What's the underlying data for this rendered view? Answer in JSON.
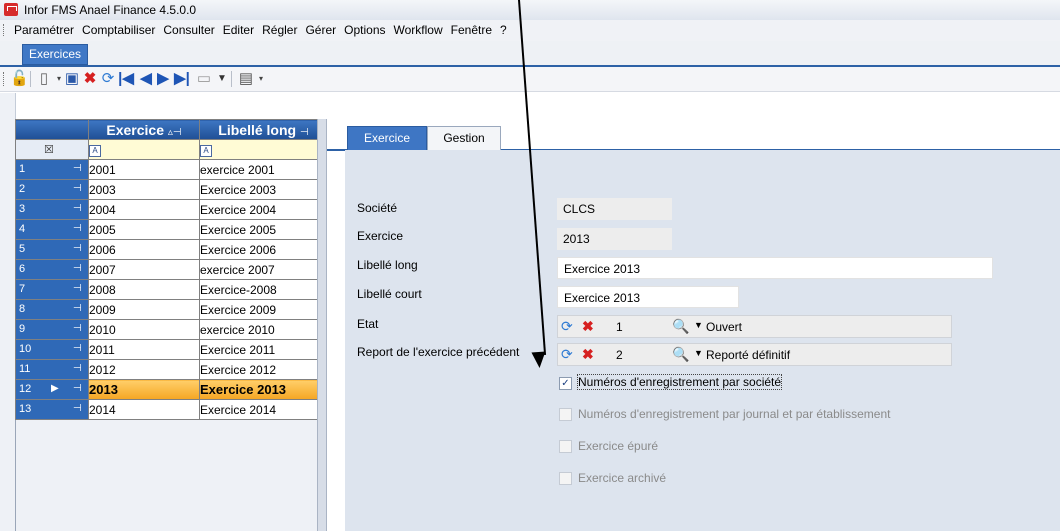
{
  "window": {
    "title": "Infor FMS Anael Finance 4.5.0.0"
  },
  "menu": [
    "Paramétrer",
    "Comptabiliser",
    "Consulter",
    "Editer",
    "Régler",
    "Gérer",
    "Options",
    "Workflow",
    "Fenêtre",
    "?"
  ],
  "doc_tab": "Exercices",
  "grid": {
    "columns": [
      "Exercice",
      "Libellé long"
    ],
    "filter_glyph": "A",
    "rows": [
      {
        "n": "1",
        "exercice": "2001",
        "libelle": "exercice 2001"
      },
      {
        "n": "2",
        "exercice": "2003",
        "libelle": "Exercice 2003"
      },
      {
        "n": "3",
        "exercice": "2004",
        "libelle": "Exercice 2004"
      },
      {
        "n": "4",
        "exercice": "2005",
        "libelle": "Exercice  2005"
      },
      {
        "n": "5",
        "exercice": "2006",
        "libelle": "Exercice 2006"
      },
      {
        "n": "6",
        "exercice": "2007",
        "libelle": "exercice 2007"
      },
      {
        "n": "7",
        "exercice": "2008",
        "libelle": "Exercice-2008"
      },
      {
        "n": "8",
        "exercice": "2009",
        "libelle": "Exercice 2009"
      },
      {
        "n": "9",
        "exercice": "2010",
        "libelle": "exercice 2010"
      },
      {
        "n": "10",
        "exercice": "2011",
        "libelle": "Exercice 2011"
      },
      {
        "n": "11",
        "exercice": "2012",
        "libelle": "Exercice 2012"
      },
      {
        "n": "12",
        "exercice": "2013",
        "libelle": "Exercice 2013"
      },
      {
        "n": "13",
        "exercice": "2014",
        "libelle": "Exercice 2014"
      }
    ],
    "selected_index": 11
  },
  "tabs": [
    "Exercice",
    "Gestion"
  ],
  "form": {
    "societe_label": "Société",
    "societe_value": "CLCS",
    "exercice_label": "Exercice",
    "exercice_value": "2013",
    "libelle_long_label": "Libellé long",
    "libelle_long_value": "Exercice 2013",
    "libelle_court_label": "Libellé court",
    "libelle_court_value": "Exercice 2013",
    "etat_label": "Etat",
    "etat_code": "1",
    "etat_value": "Ouvert",
    "report_label": "Report de l'exercice précédent",
    "report_code": "2",
    "report_value": "Reporté définitif"
  },
  "checkboxes": [
    {
      "label": "Numéros d'enregistrement par société",
      "checked": true,
      "enabled": true
    },
    {
      "label": "Numéros d'enregistrement par journal et par établissement",
      "checked": false,
      "enabled": false
    },
    {
      "label": "Exercice épuré",
      "checked": false,
      "enabled": false
    },
    {
      "label": "Exercice archivé",
      "checked": false,
      "enabled": false
    }
  ]
}
